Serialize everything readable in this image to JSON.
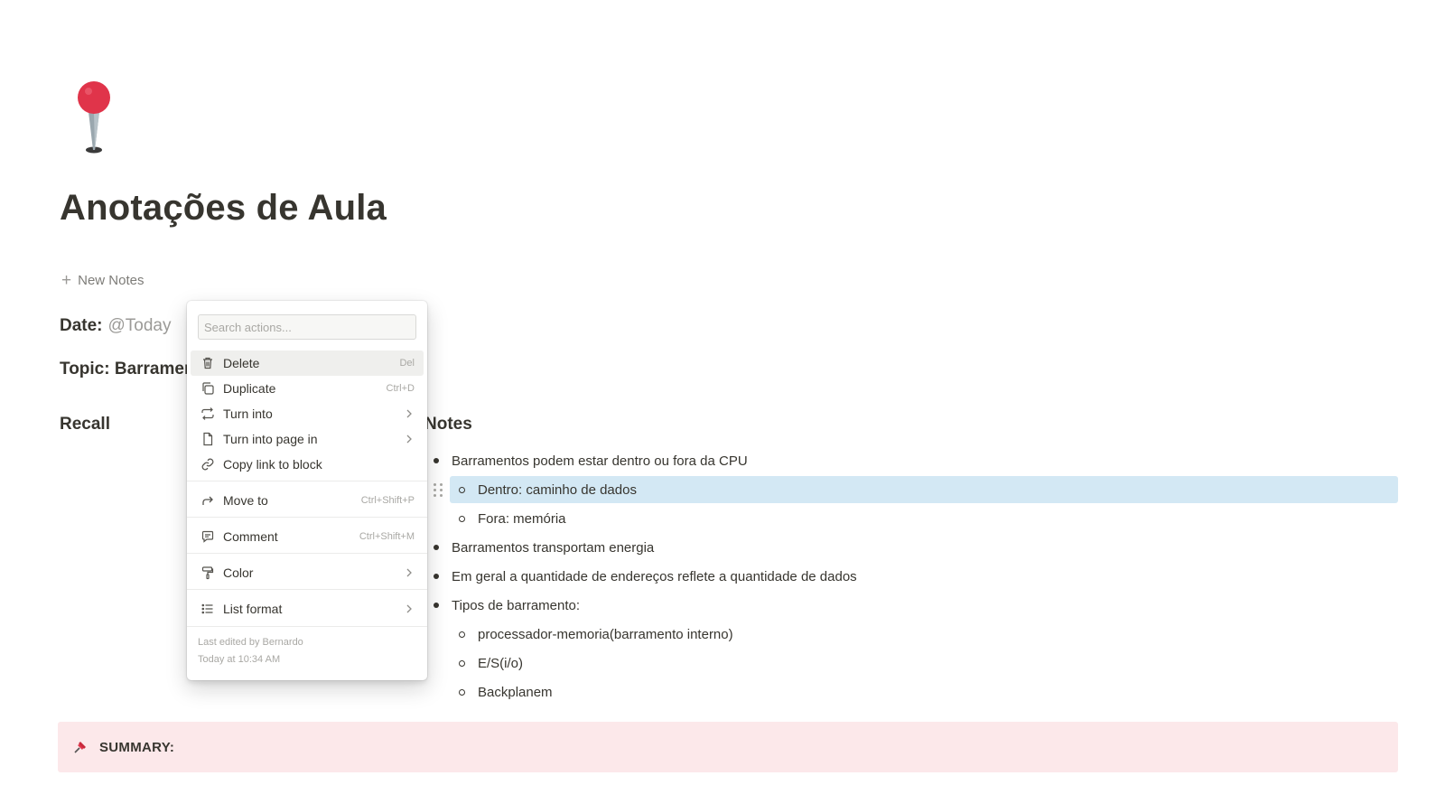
{
  "page": {
    "title": "Anotações de Aula",
    "icon": "pushpin-round-icon",
    "new_notes_label": "New Notes",
    "date_label": "Date:",
    "date_value": "@Today",
    "topic_label": "Topic: Barramer"
  },
  "columns": {
    "recall_heading": "Recall",
    "notes_heading": "Notes"
  },
  "notes": [
    {
      "level": 1,
      "text": "Barramentos podem estar dentro ou fora da CPU"
    },
    {
      "level": 2,
      "text": "Dentro: caminho de dados",
      "selected": true
    },
    {
      "level": 2,
      "text": "Fora: memória"
    },
    {
      "level": 1,
      "text": "Barramentos transportam energia"
    },
    {
      "level": 1,
      "text": "Em geral a quantidade de endereços reflete a quantidade de dados"
    },
    {
      "level": 1,
      "text": "Tipos de barramento:"
    },
    {
      "level": 2,
      "text": "processador-memoria(barramento interno)"
    },
    {
      "level": 2,
      "text": "E/S(i/o)"
    },
    {
      "level": 2,
      "text": "Backplanem"
    }
  ],
  "summary": {
    "icon": "pushpin-icon",
    "label": "SUMMARY:"
  },
  "context_menu": {
    "search_placeholder": "Search actions...",
    "items": [
      {
        "label": "Delete",
        "shortcut": "Del",
        "icon": "trash-icon"
      },
      {
        "label": "Duplicate",
        "shortcut": "Ctrl+D",
        "icon": "duplicate-icon"
      },
      {
        "label": "Turn into",
        "icon": "turn-into-icon"
      },
      {
        "label": "Turn into page in",
        "icon": "page-icon"
      },
      {
        "label": "Copy link to block",
        "icon": "link-icon"
      },
      {
        "label": "Move to",
        "shortcut": "Ctrl+Shift+P",
        "icon": "move-arrow-icon"
      },
      {
        "label": "Comment",
        "shortcut": "Ctrl+Shift+M",
        "icon": "comment-icon"
      },
      {
        "label": "Color",
        "icon": "paint-roller-icon"
      },
      {
        "label": "List format",
        "icon": "list-icon"
      }
    ],
    "footer_line1": "Last edited by Bernardo",
    "footer_line2": "Today at 10:34 AM"
  },
  "colors": {
    "selection": "#d3e8f4",
    "summary_bg": "#fce8ea",
    "pin_red": "#e0344a"
  }
}
